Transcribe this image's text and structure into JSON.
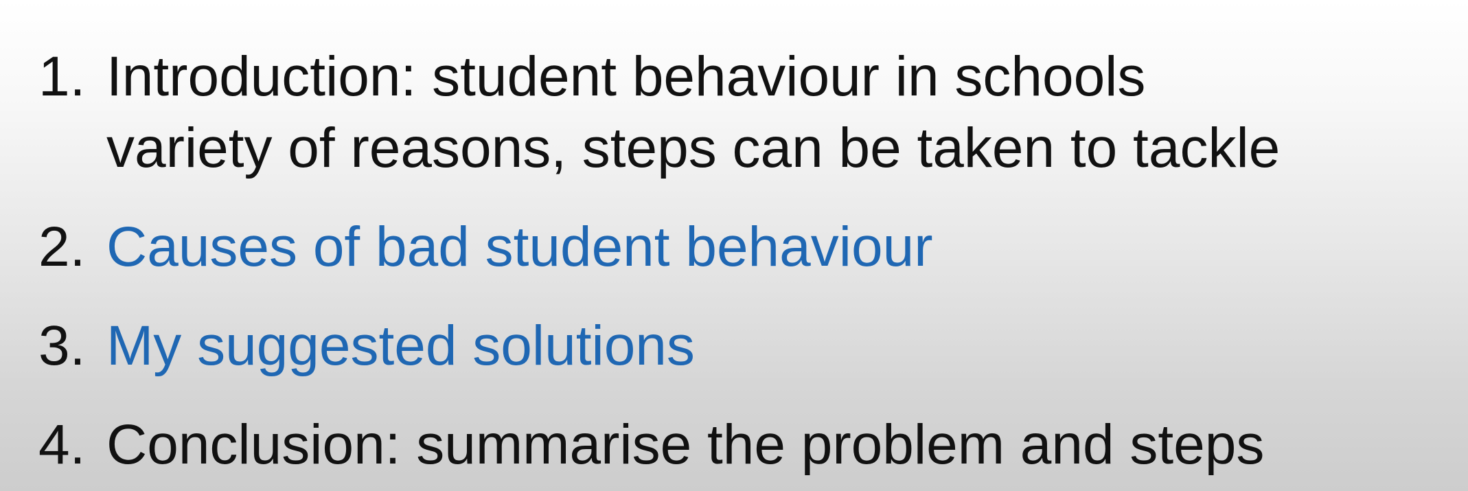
{
  "outline": {
    "items": [
      {
        "number": "1.",
        "lines": [
          "Introduction: student behaviour in schools",
          "variety of reasons, steps can be taken to tackle"
        ]
      },
      {
        "number": "2.",
        "text": "Causes of bad student behaviour"
      },
      {
        "number": "3.",
        "text": "My suggested solutions"
      },
      {
        "number": "4.",
        "text": "Conclusion: summarise the problem and steps"
      }
    ]
  },
  "colors": {
    "text": "#111111",
    "accent_blue": "#1f67b3",
    "background_top": "#ffffff",
    "background_bottom": "#cdcdcd"
  }
}
